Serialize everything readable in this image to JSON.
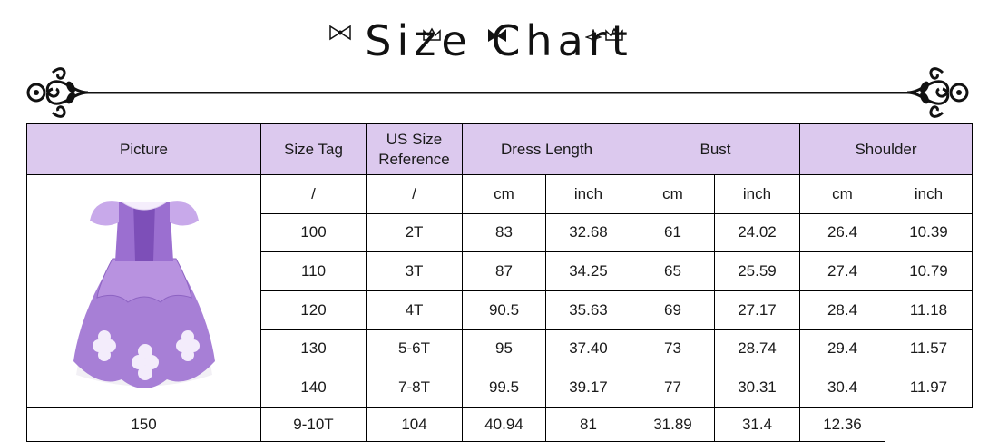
{
  "title": "Size Chart",
  "headers": {
    "picture": "Picture",
    "size_tag": "Size Tag",
    "us_size": "US Size Reference",
    "dress_length": "Dress Length",
    "bust": "Bust",
    "shoulder": "Shoulder"
  },
  "units_row": [
    "/",
    "/",
    "cm",
    "inch",
    "cm",
    "inch",
    "cm",
    "inch"
  ],
  "rows": [
    [
      "100",
      "2T",
      "83",
      "32.68",
      "61",
      "24.02",
      "26.4",
      "10.39"
    ],
    [
      "110",
      "3T",
      "87",
      "34.25",
      "65",
      "25.59",
      "27.4",
      "10.79"
    ],
    [
      "120",
      "4T",
      "90.5",
      "35.63",
      "69",
      "27.17",
      "28.4",
      "11.18"
    ],
    [
      "130",
      "5-6T",
      "95",
      "37.40",
      "73",
      "28.74",
      "29.4",
      "11.57"
    ],
    [
      "140",
      "7-8T",
      "99.5",
      "39.17",
      "77",
      "30.31",
      "30.4",
      "11.97"
    ],
    [
      "150",
      "9-10T",
      "104",
      "40.94",
      "81",
      "31.89",
      "31.4",
      "12.36"
    ]
  ],
  "colors": {
    "header_bg": "#dcc9ee",
    "dress_purple": "#a77fd6",
    "dress_light": "#c8a9ea"
  },
  "icons": [
    "bow-icon",
    "crown-icon",
    "sparkle-icon",
    "scroll-ornament-icon",
    "princess-dress-image"
  ]
}
